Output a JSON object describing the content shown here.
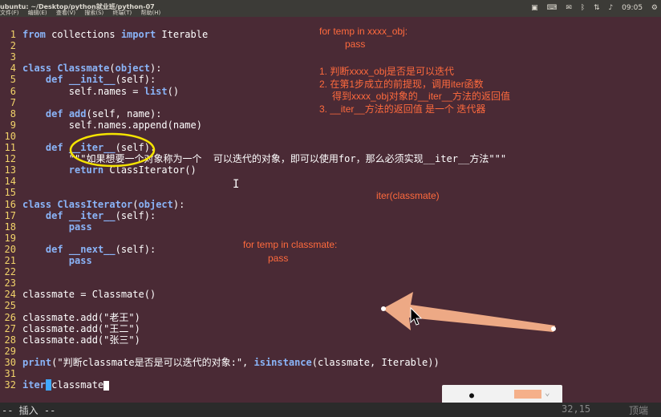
{
  "window": {
    "title": "ubuntu: ~/Desktop/python就业班/python-07",
    "menus": [
      "文件(F)",
      "编辑(E)",
      "查看(V)",
      "搜索(S)",
      "终端(T)",
      "帮助(H)"
    ],
    "tray": {
      "time": "09:05"
    },
    "tray_icons": [
      "terminal-tray-icon",
      "keyboard-layout-icon",
      "mail-icon",
      "bluetooth-icon",
      "wifi-icon",
      "volume-icon",
      "clock-icon",
      "settings-icon"
    ]
  },
  "lines": [
    {
      "n": "1",
      "parts": [
        [
          "kw",
          "from"
        ],
        [
          "t",
          " collections "
        ],
        [
          "kw",
          "import"
        ],
        [
          "t",
          " Iterable"
        ]
      ]
    },
    {
      "n": "2",
      "parts": []
    },
    {
      "n": "3",
      "parts": []
    },
    {
      "n": "4",
      "parts": [
        [
          "kw",
          "class"
        ],
        [
          "t",
          " "
        ],
        [
          "fn",
          "Classmate"
        ],
        [
          "t",
          "("
        ],
        [
          "fn",
          "object"
        ],
        [
          "t",
          "):"
        ]
      ]
    },
    {
      "n": "5",
      "parts": [
        [
          "t",
          "    "
        ],
        [
          "kw",
          "def"
        ],
        [
          "t",
          " "
        ],
        [
          "fn",
          "__init__"
        ],
        [
          "t",
          "(self):"
        ]
      ]
    },
    {
      "n": "6",
      "parts": [
        [
          "t",
          "        self.names = "
        ],
        [
          "fn",
          "list"
        ],
        [
          "t",
          "()"
        ]
      ]
    },
    {
      "n": "7",
      "parts": []
    },
    {
      "n": "8",
      "parts": [
        [
          "t",
          "    "
        ],
        [
          "kw",
          "def"
        ],
        [
          "t",
          " "
        ],
        [
          "fn",
          "add"
        ],
        [
          "t",
          "(self, name):"
        ]
      ]
    },
    {
      "n": "9",
      "parts": [
        [
          "t",
          "        self.names.append(name)"
        ]
      ]
    },
    {
      "n": "10",
      "parts": []
    },
    {
      "n": "11",
      "parts": [
        [
          "t",
          "    "
        ],
        [
          "kw",
          "def"
        ],
        [
          "t",
          " "
        ],
        [
          "fn",
          "__iter__"
        ],
        [
          "t",
          "(self):"
        ]
      ]
    },
    {
      "n": "12",
      "parts": [
        [
          "t",
          "        \"\"\"如果想要一个对象称为一个  可以迭代的对象，即可以使用for，那么必须实现__iter__方法\"\"\""
        ]
      ]
    },
    {
      "n": "13",
      "parts": [
        [
          "t",
          "        "
        ],
        [
          "kw",
          "return"
        ],
        [
          "t",
          " ClassIterator()"
        ]
      ]
    },
    {
      "n": "14",
      "parts": []
    },
    {
      "n": "15",
      "parts": []
    },
    {
      "n": "16",
      "parts": [
        [
          "kw",
          "class"
        ],
        [
          "t",
          " "
        ],
        [
          "fn",
          "ClassIterator"
        ],
        [
          "t",
          "("
        ],
        [
          "fn",
          "object"
        ],
        [
          "t",
          "):"
        ]
      ]
    },
    {
      "n": "17",
      "parts": [
        [
          "t",
          "    "
        ],
        [
          "kw",
          "def"
        ],
        [
          "t",
          " "
        ],
        [
          "fn",
          "__iter__"
        ],
        [
          "t",
          "(self):"
        ]
      ]
    },
    {
      "n": "18",
      "parts": [
        [
          "t",
          "        "
        ],
        [
          "kw",
          "pass"
        ]
      ]
    },
    {
      "n": "19",
      "parts": []
    },
    {
      "n": "20",
      "parts": [
        [
          "t",
          "    "
        ],
        [
          "kw",
          "def"
        ],
        [
          "t",
          " "
        ],
        [
          "fn",
          "__next__"
        ],
        [
          "t",
          "(self):"
        ]
      ]
    },
    {
      "n": "21",
      "parts": [
        [
          "t",
          "        "
        ],
        [
          "kw",
          "pass"
        ]
      ]
    },
    {
      "n": "22",
      "parts": []
    },
    {
      "n": "23",
      "parts": []
    },
    {
      "n": "24",
      "parts": [
        [
          "t",
          "classmate = Classmate()"
        ]
      ]
    },
    {
      "n": "25",
      "parts": []
    },
    {
      "n": "26",
      "parts": [
        [
          "t",
          "classmate.add(\"老王\")"
        ]
      ]
    },
    {
      "n": "27",
      "parts": [
        [
          "t",
          "classmate.add(\"王二\")"
        ]
      ]
    },
    {
      "n": "28",
      "parts": [
        [
          "t",
          "classmate.add(\"张三\")"
        ]
      ]
    },
    {
      "n": "29",
      "parts": []
    },
    {
      "n": "30",
      "parts": [
        [
          "kw",
          "print"
        ],
        [
          "t",
          "(\"判断classmate是否是可以迭代的对象:\", "
        ],
        [
          "kw",
          "isinstance"
        ],
        [
          "t",
          "(classmate, Iterable))"
        ]
      ]
    },
    {
      "n": "31",
      "parts": []
    },
    {
      "n": "32",
      "parts": [
        [
          "kw",
          "iter"
        ],
        [
          "cur",
          "("
        ],
        [
          "t",
          "classmate"
        ],
        [
          "caret",
          ""
        ]
      ]
    }
  ],
  "annotations": [
    {
      "text": "for temp in xxxx_obj:"
    },
    {
      "text": "pass"
    },
    {
      "text": "1. 判断xxxx_obj是否是可以迭代"
    },
    {
      "text": "2. 在第1步成立的前提现，调用iter函数"
    },
    {
      "text": "得到xxxx_obj对象的__iter__方法的返回值"
    },
    {
      "text": "3. __iter__方法的返回值 是一个 迭代器"
    },
    {
      "text": "iter(classmate)"
    },
    {
      "text": "for temp in classmate:"
    },
    {
      "text": "pass"
    }
  ],
  "status": {
    "mode": "-- 插入 --",
    "position": "32,15",
    "scroll": "顶端"
  },
  "pen_toolbar": {
    "color": "#f5b08a"
  }
}
